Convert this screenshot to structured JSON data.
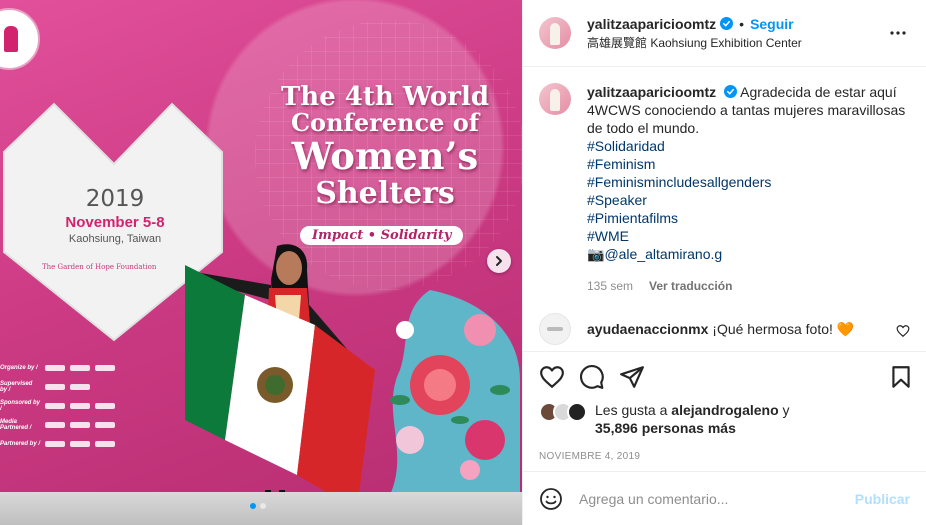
{
  "post": {
    "username": "yalitzaaparicioomtz",
    "follow_label": "Seguir",
    "separator": "•",
    "location": "高雄展覽館 Kaohsiung Exhibition Center",
    "more_icon": "more-horizontal-icon"
  },
  "media": {
    "conference_title_line1": "The 4th World",
    "conference_title_line2": "Conference of",
    "conference_title_line3": "Women’s",
    "conference_title_line4": "Shelters",
    "tagline": "Impact • Solidarity",
    "year": "2019",
    "dates": "November 5-8",
    "city": "Kaohsiung, Taiwan",
    "foundation": "The Garden of Hope Foundation",
    "sponsor_labels": [
      "Organize by /",
      "Supervised by /",
      "Sponsored by /",
      "Media Partnered /",
      "Partnered by /"
    ],
    "carousel": {
      "current": 1,
      "total": 2
    }
  },
  "caption": {
    "username": "yalitzaaparicioomtz",
    "text": "Agradecida de estar aquí 4WCWS conociendo a tantas mujeres maravillosas de todo el mundo.",
    "hashtags": [
      "#Solidaridad",
      "#Feminism",
      "#Feminismincludesallgenders",
      "#Speaker",
      "#Pimientafilms",
      "#WME"
    ],
    "camera_emoji": "📷",
    "mention": "@ale_altamirano.g",
    "age": "135 sem",
    "translate_label": "Ver traducción"
  },
  "comments": [
    {
      "username": "ayudaenaccionmx",
      "text": "¡Qué hermosa foto!",
      "emoji": "🧡"
    }
  ],
  "likes": {
    "prefix": "Les gusta a",
    "user": "alejandrogaleno",
    "conj": "y",
    "count": "35,896 personas más"
  },
  "date": "NOVIEMBRE 4, 2019",
  "add_comment": {
    "placeholder": "Agrega un comentario...",
    "publish_label": "Publicar"
  },
  "colors": {
    "accent": "#0095f6",
    "link": "#00376b",
    "muted": "#8e8e8e",
    "poster_pink": "#cc3b84"
  }
}
